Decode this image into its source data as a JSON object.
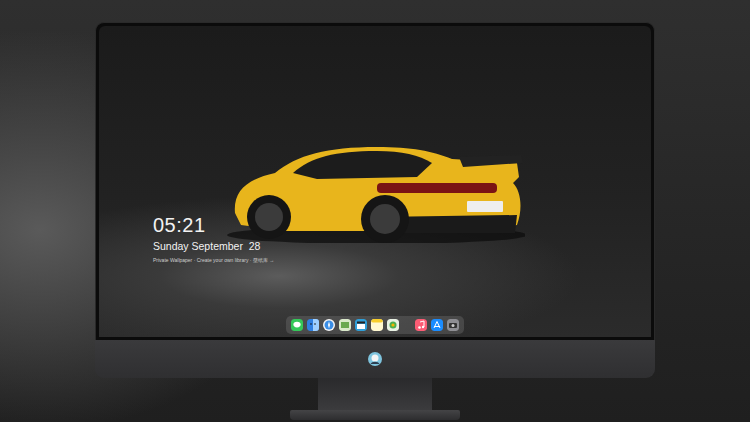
{
  "desktop": {
    "clock": {
      "time": "05:21",
      "date": "Sunday September  28",
      "note": "Private Wallpaper · Create your own library · 壁纸库 →"
    }
  }
}
